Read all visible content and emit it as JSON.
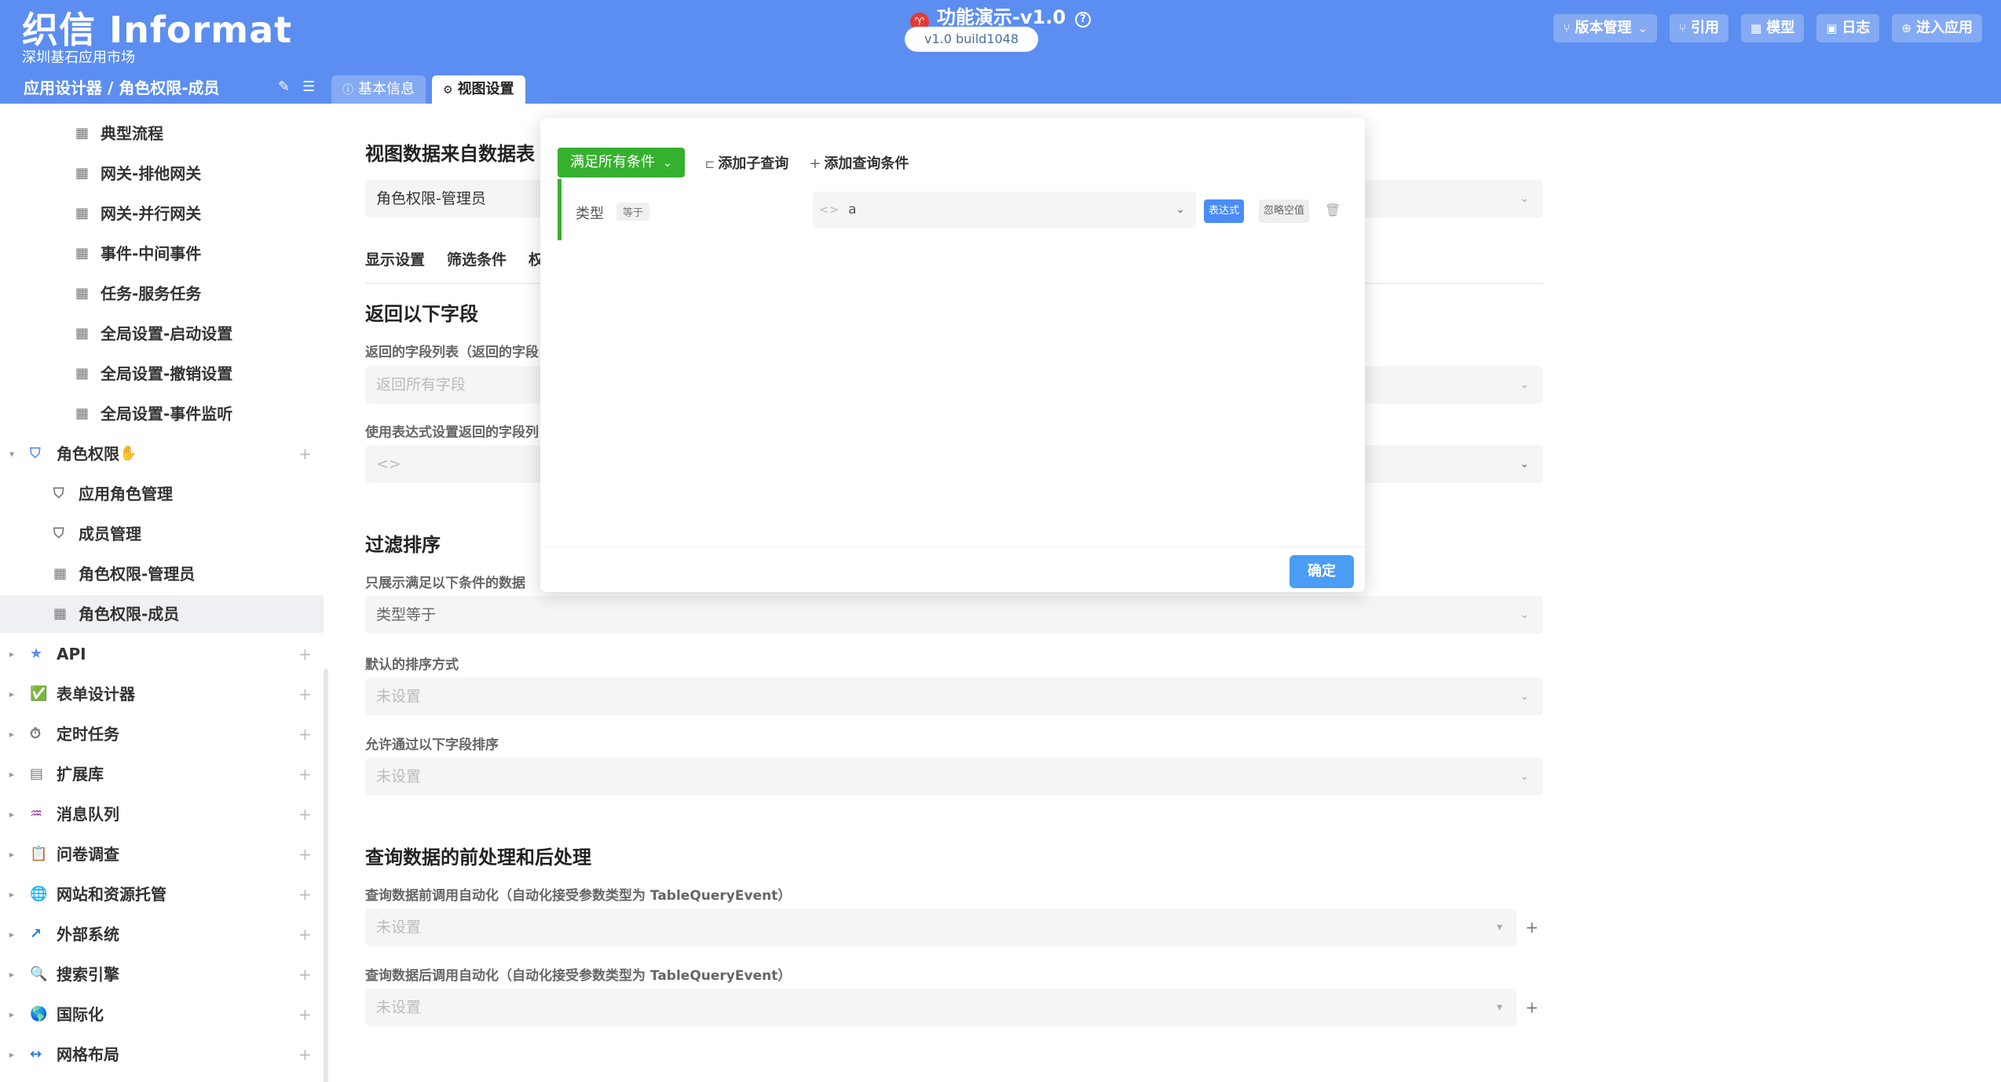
{
  "header": {
    "logo_title": "织信 Informat",
    "logo_sub": "深圳基石应用市场",
    "app_title": "功能演示-v1.0",
    "version": "v1.0 build1048",
    "actions": [
      "版本管理",
      "引用",
      "模型",
      "日志",
      "进入应用"
    ]
  },
  "subbar": {
    "breadcrumb": "应用设计器 / 角色权限-成员",
    "tabs": [
      "基本信息",
      "视图设置"
    ]
  },
  "sidebar": {
    "items": [
      {
        "label": "典型流程"
      },
      {
        "label": "网关-排他网关"
      },
      {
        "label": "网关-并行网关"
      },
      {
        "label": "事件-中间事件"
      },
      {
        "label": "任务-服务任务"
      },
      {
        "label": "全局设置-启动设置"
      },
      {
        "label": "全局设置-撤销设置"
      },
      {
        "label": "全局设置-事件监听"
      },
      {
        "label": "角色权限"
      },
      {
        "label": "应用角色管理"
      },
      {
        "label": "成员管理"
      },
      {
        "label": "角色权限-管理员"
      },
      {
        "label": "角色权限-成员"
      },
      {
        "label": "API"
      },
      {
        "label": "表单设计器"
      },
      {
        "label": "定时任务"
      },
      {
        "label": "扩展库"
      },
      {
        "label": "消息队列"
      },
      {
        "label": "问卷调查"
      },
      {
        "label": "网站和资源托管"
      },
      {
        "label": "外部系统"
      },
      {
        "label": "搜索引擎"
      },
      {
        "label": "国际化"
      },
      {
        "label": "网格布局"
      }
    ]
  },
  "main": {
    "source_heading": "视图数据来自数据表",
    "source_value": "角色权限-管理员",
    "subtabs": [
      "显示设置",
      "筛选条件",
      "权"
    ],
    "return_heading": "返回以下字段",
    "return_list_label": "返回的字段列表（返回的字段",
    "return_list_placeholder": "返回所有字段",
    "return_expr_label": "使用表达式设置返回的字段列",
    "filter_heading": "过滤排序",
    "filter_label": "只展示满足以下条件的数据",
    "filter_value": "类型等于",
    "sort_label": "默认的排序方式",
    "sort_value": "未设置",
    "allow_sort_label": "允许通过以下字段排序",
    "allow_sort_value": "未设置",
    "process_heading": "查询数据的前处理和后处理",
    "pre_label": "查询数据前调用自动化（自动化接受参数类型为 TableQueryEvent）",
    "pre_value": "未设置",
    "post_label": "查询数据后调用自动化（自动化接受参数类型为 TableQueryEvent）",
    "post_value": "未设置"
  },
  "modal": {
    "match_all": "满足所有条件",
    "add_subquery": "添加子查询",
    "add_condition": "添加查询条件",
    "condition": {
      "field": "类型",
      "operator": "等于",
      "value": "a",
      "expr_btn": "表达式",
      "ignore_btn": "忽略空值"
    },
    "ok": "确定"
  },
  "colors": {
    "header_bg": "#5b8ef0",
    "green": "#36b12f",
    "blue": "#4a9cf5"
  }
}
